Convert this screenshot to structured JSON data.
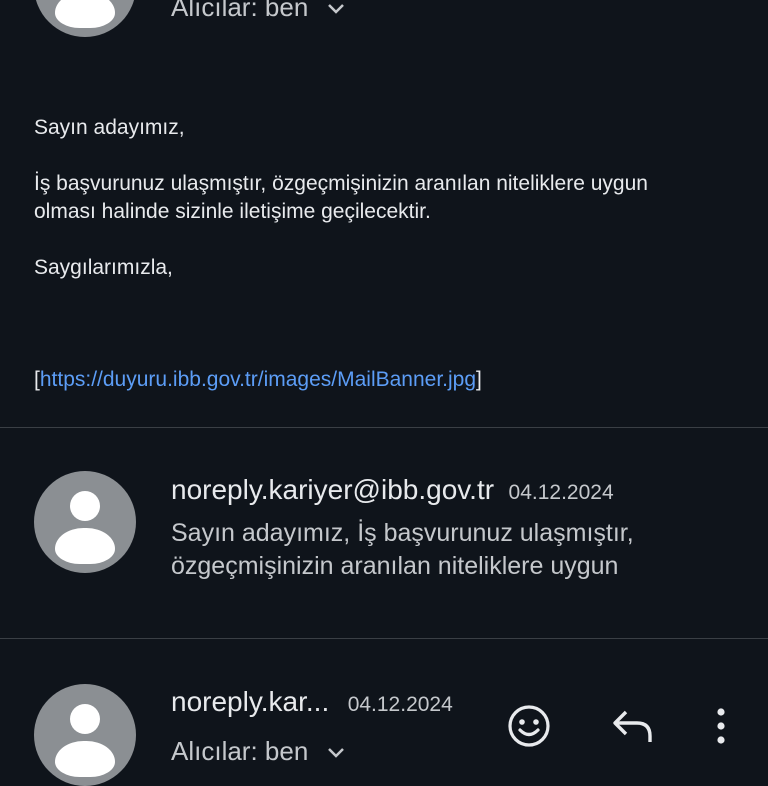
{
  "top_message": {
    "recipients_label": "Alıcılar: ben",
    "body": {
      "greeting": "Sayın adayımız,",
      "line1": "İş başvurunuz ulaşmıştır, özgeçmişinizin aranılan niteliklere uygun",
      "line2": "olması halinde sizinle iletişime geçilecektir.",
      "closing": "Saygılarımızla,",
      "bracket_open": "[",
      "link": "https://duyuru.ibb.gov.tr/images/MailBanner.jpg",
      "bracket_close": "]"
    }
  },
  "collapsed_message": {
    "sender": "noreply.kariyer@ibb.gov.tr",
    "date": "04.12.2024",
    "snippet_line1": "Sayın adayımız, İş başvurunuz ulaşmıştır,",
    "snippet_line2": "özgeçmişinizin aranılan niteliklere uygun"
  },
  "bottom_message": {
    "sender": "noreply.kar...",
    "date": "04.12.2024",
    "recipients_label": "Alıcılar: ben"
  },
  "icons": {
    "emoji": "emoji-reaction-icon",
    "reply": "reply-icon",
    "more": "more-vert-icon"
  },
  "colors": {
    "background": "#0f141b",
    "link": "#5c9df6",
    "avatar": "#8b8f93"
  }
}
